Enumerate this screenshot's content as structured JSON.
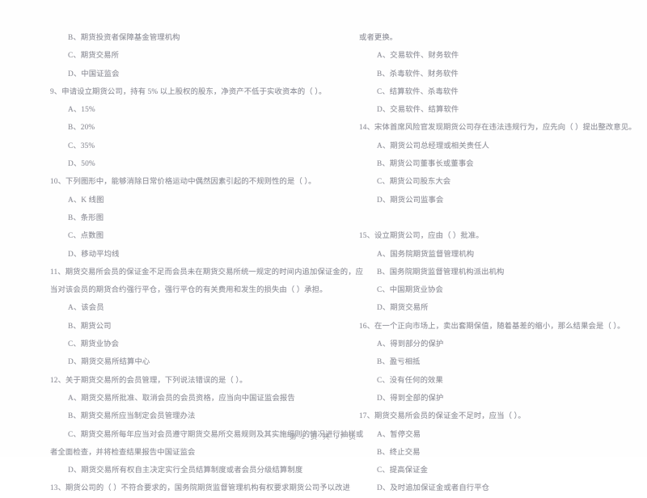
{
  "document": {
    "type": "scanned-exam-paper",
    "language": "zh-CN",
    "footer": "第 2 页 共 17 页",
    "page_number": "2",
    "total_pages": "17",
    "text_color": "#90919a",
    "background_color": "#fefefe"
  },
  "left_column": {
    "blocks": [
      {
        "kind": "options_tail",
        "lines": [
          "B、期货投资者保障基金管理机构",
          "C、期货交易所",
          "D、中国证监会"
        ]
      },
      {
        "kind": "question",
        "number": "9",
        "stem": "9、申请设立期货公司，持有 5% 以上股权的股东，净资产不低于实收资本的（      ）。",
        "options": [
          "A、15%",
          "B、20%",
          "C、35%",
          "D、50%"
        ]
      },
      {
        "kind": "question",
        "number": "10",
        "stem": "10、下列图形中，能够消除日常价格运动中偶然因素引起的不规则性的是（      ）。",
        "options": [
          "A、K 线图",
          "B、条形图",
          "C、点数图",
          "D、移动平均线"
        ]
      },
      {
        "kind": "question",
        "number": "11",
        "stem": "11、期货交易所会员的保证金不足而会员未在期货交易所统一规定的时间内追加保证金的，应",
        "stem_cont": "当对该会员的期货合约强行平仓，强行平仓的有关费用和发生的损失由（      ）承担。",
        "options": [
          "A、该会员",
          "B、期货公司",
          "C、期货业协会",
          "D、期货交易所结算中心"
        ]
      },
      {
        "kind": "question",
        "number": "12",
        "stem": "12、关于期货交易所的会员管理，下列说法错误的是（      ）。",
        "options": [
          "A、期货交易所批准、取消会员的会员资格，应当向中国证监会报告",
          "B、期货交易所应当制定会员管理办法",
          "C、期货交易所每年应当对会员遵守期货交易所交易规则及其实施细则的情况进行抽样或",
          "者全面检查，并将检查结果报告中国证监会",
          "D、期货交易所有权自主决定实行全员结算制度或者会员分级结算制度"
        ]
      },
      {
        "kind": "question",
        "number": "13",
        "stem": "13、期货公司的（      ）不符合要求的，国务院期货监督管理机构有权要求期货公司予以改进"
      }
    ]
  },
  "right_column": {
    "blocks": [
      {
        "kind": "stem_tail",
        "lines": [
          "或者更换。"
        ]
      },
      {
        "kind": "options_tail",
        "lines": [
          "A、交易软件、财务软件",
          "B、杀毒软件、财务软件",
          "C、结算软件、杀毒软件",
          "D、交易软件、结算软件"
        ]
      },
      {
        "kind": "question",
        "number": "14",
        "stem": "14、宋体首席风险官发现期货公司存在违法违规行为，应先向（      ）提出整改意见。",
        "options": [
          "A、期货公司总经理或相关责任人",
          "B、期货公司董事长或董事会",
          "C、期货公司股东大会",
          "D、期货公司监事会"
        ]
      },
      {
        "kind": "question",
        "number": "15",
        "stem": "15、设立期货公司，应由（      ）批准。",
        "options": [
          "A、国务院期货监督管理机构",
          "B、国务院期货监督管理机构派出机构",
          "C、中国期货业协会",
          "D、期货交易所"
        ]
      },
      {
        "kind": "question",
        "number": "16",
        "stem": "16、在一个正向市场上，卖出套期保值，随着基差的缩小，那么结果会是（      ）。",
        "options": [
          "A、得到部分的保护",
          "B、盈亏相抵",
          "C、没有任何的效果",
          "D、得到全部的保护"
        ]
      },
      {
        "kind": "question",
        "number": "17",
        "stem": "17、期货交易所会员的保证金不足时，应当（      ）。",
        "options": [
          "A、暂停交易",
          "B、终止交易",
          "C、提高保证金",
          "D、及时追加保证金或者自行平仓"
        ]
      }
    ]
  }
}
